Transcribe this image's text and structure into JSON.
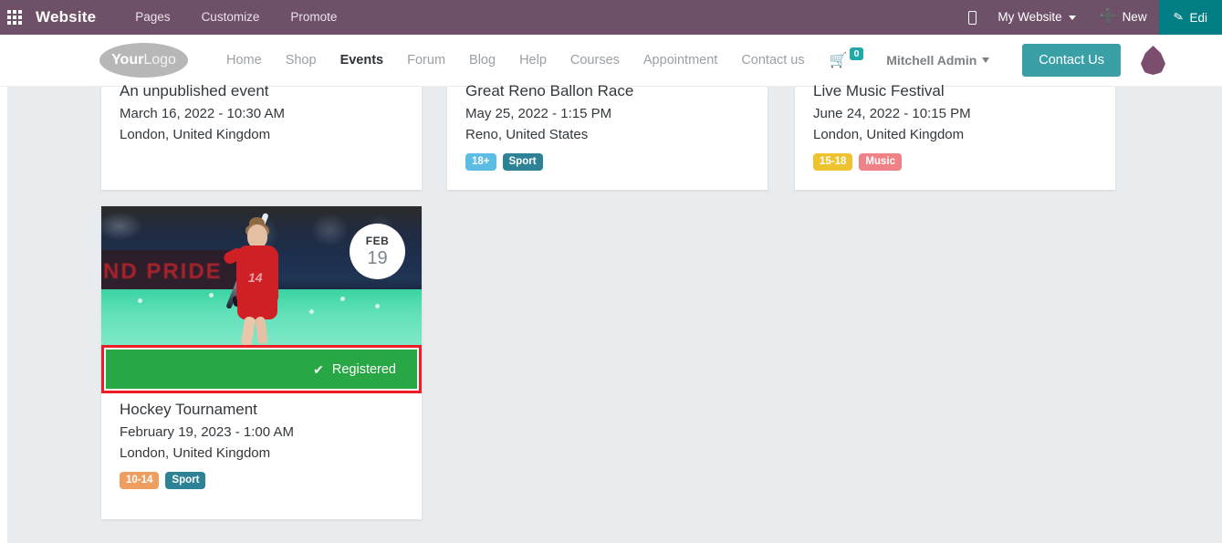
{
  "odoo_topbar": {
    "apps_icon": "apps-grid-icon",
    "brand": "Website",
    "menu": [
      "Pages",
      "Customize",
      "Promote"
    ],
    "mobile_preview_icon": "mobile-phone-icon",
    "website_selector": "My Website",
    "new_label": "New",
    "new_icon": "plus-icon",
    "edit_label": "Edi",
    "edit_icon": "pencil-icon",
    "colors": {
      "bar": "#6E5168",
      "edit_button": "#017E84"
    }
  },
  "site_header": {
    "logo": {
      "bold": "Your",
      "light": "Logo"
    },
    "nav": [
      {
        "label": "Home",
        "active": false
      },
      {
        "label": "Shop",
        "active": false
      },
      {
        "label": "Events",
        "active": true
      },
      {
        "label": "Forum",
        "active": false
      },
      {
        "label": "Blog",
        "active": false
      },
      {
        "label": "Help",
        "active": false
      },
      {
        "label": "Courses",
        "active": false
      },
      {
        "label": "Appointment",
        "active": false
      },
      {
        "label": "Contact us",
        "active": false
      }
    ],
    "cart": {
      "icon": "shopping-cart-icon",
      "count": "0"
    },
    "user": "Mitchell Admin",
    "contact_button": "Contact Us",
    "livechat_icon": "livechat-bubble-icon",
    "colors": {
      "cart_badge": "#20a9a9",
      "contact_button": "#3AA0A5",
      "livechat": "#7B4D6E"
    }
  },
  "events": {
    "top_row": [
      {
        "title": "An unpublished event",
        "date": "March 16, 2022 - 10:30 AM",
        "location": "London, United Kingdom",
        "tags": []
      },
      {
        "title": "Great Reno Ballon Race",
        "date": "May 25, 2022 - 1:15 PM",
        "location": "Reno, United States",
        "tags": [
          {
            "label": "18+",
            "color": "#5BBCE4"
          },
          {
            "label": "Sport",
            "color": "#2E8296"
          }
        ]
      },
      {
        "title": "Live Music Festival",
        "date": "June 24, 2022 - 10:15 PM",
        "location": "London, United Kingdom",
        "tags": [
          {
            "label": "15-18",
            "color": "#EFC32F"
          },
          {
            "label": "Music",
            "color": "#EF8287"
          }
        ]
      }
    ],
    "featured": {
      "image_alt": "field-hockey-player-photo",
      "date_badge": {
        "month": "FEB",
        "day": "19"
      },
      "registered_label": "Registered",
      "registered_icon": "check-icon",
      "highlight_color": "#EE1C25",
      "registered_color": "#28A745",
      "title": "Hockey Tournament",
      "date": "February 19, 2023 - 1:00 AM",
      "location": "London, United Kingdom",
      "tags": [
        {
          "label": "10-14",
          "color": "#EE9E5E"
        },
        {
          "label": "Sport",
          "color": "#2E8296"
        }
      ]
    }
  }
}
